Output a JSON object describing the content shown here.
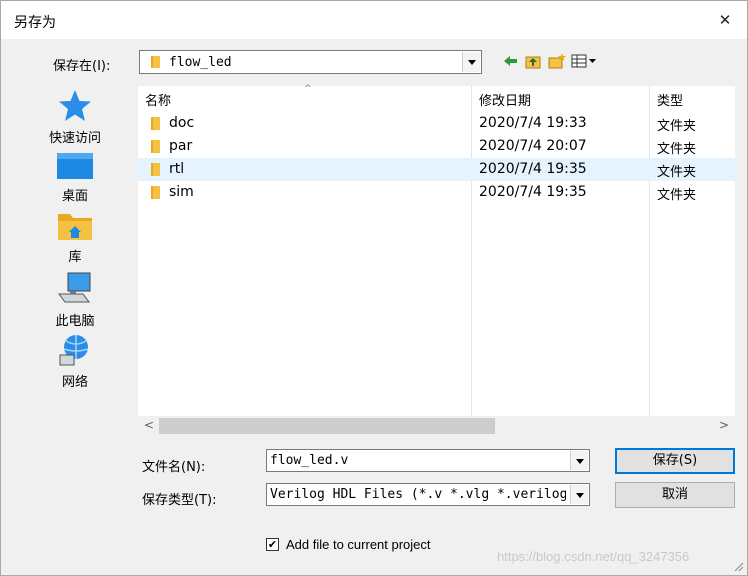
{
  "window": {
    "title": "另存为",
    "close_glyph": "✕"
  },
  "look_in": {
    "label": "保存在(I):",
    "value": "flow_led"
  },
  "places": [
    {
      "label": "快速访问",
      "icon": "star-icon"
    },
    {
      "label": "桌面",
      "icon": "desktop-icon"
    },
    {
      "label": "库",
      "icon": "library-icon"
    },
    {
      "label": "此电脑",
      "icon": "computer-icon"
    },
    {
      "label": "网络",
      "icon": "network-icon"
    }
  ],
  "file_list": {
    "columns": {
      "name": "名称",
      "modified": "修改日期",
      "type": "类型"
    },
    "rows": [
      {
        "name": "doc",
        "modified": "2020/7/4 19:33",
        "type": "文件夹",
        "selected": false
      },
      {
        "name": "par",
        "modified": "2020/7/4 20:07",
        "type": "文件夹",
        "selected": false
      },
      {
        "name": "rtl",
        "modified": "2020/7/4 19:35",
        "type": "文件夹",
        "selected": true
      },
      {
        "name": "sim",
        "modified": "2020/7/4 19:35",
        "type": "文件夹",
        "selected": false
      }
    ]
  },
  "filename": {
    "label": "文件名(N):",
    "value": "flow_led.v"
  },
  "filetype": {
    "label": "保存类型(T):",
    "value": "Verilog HDL Files (*.v *.vlg *.verilog"
  },
  "buttons": {
    "save": "保存(S)",
    "cancel": "取消"
  },
  "add_to_project": {
    "label": "Add file to current project",
    "checked": true,
    "check_glyph": "✔"
  },
  "watermark": "https://blog.csdn.net/qq_3247356",
  "colors": {
    "selection": "#e5f3ff",
    "accent": "#0078d7",
    "folder": "#f5c143"
  }
}
